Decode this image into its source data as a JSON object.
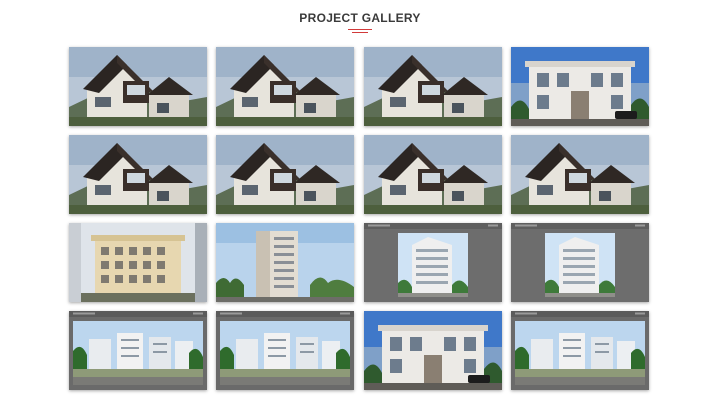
{
  "header": {
    "title": "PROJECT GALLERY",
    "accent_color": "#d23a3a"
  },
  "gallery": {
    "items": [
      {
        "scene": "dark-gable-villa"
      },
      {
        "scene": "dark-gable-villa"
      },
      {
        "scene": "dark-gable-villa"
      },
      {
        "scene": "white-classic-villa"
      },
      {
        "scene": "dark-gable-villa"
      },
      {
        "scene": "dark-gable-villa"
      },
      {
        "scene": "dark-gable-villa"
      },
      {
        "scene": "dark-gable-villa"
      },
      {
        "scene": "cream-apartment-block"
      },
      {
        "scene": "highrise-tower"
      },
      {
        "scene": "perspective-render-tower"
      },
      {
        "scene": "perspective-render-tower"
      },
      {
        "scene": "perspective-render-township"
      },
      {
        "scene": "perspective-render-township"
      },
      {
        "scene": "white-classic-villa"
      },
      {
        "scene": "perspective-render-township"
      }
    ]
  }
}
